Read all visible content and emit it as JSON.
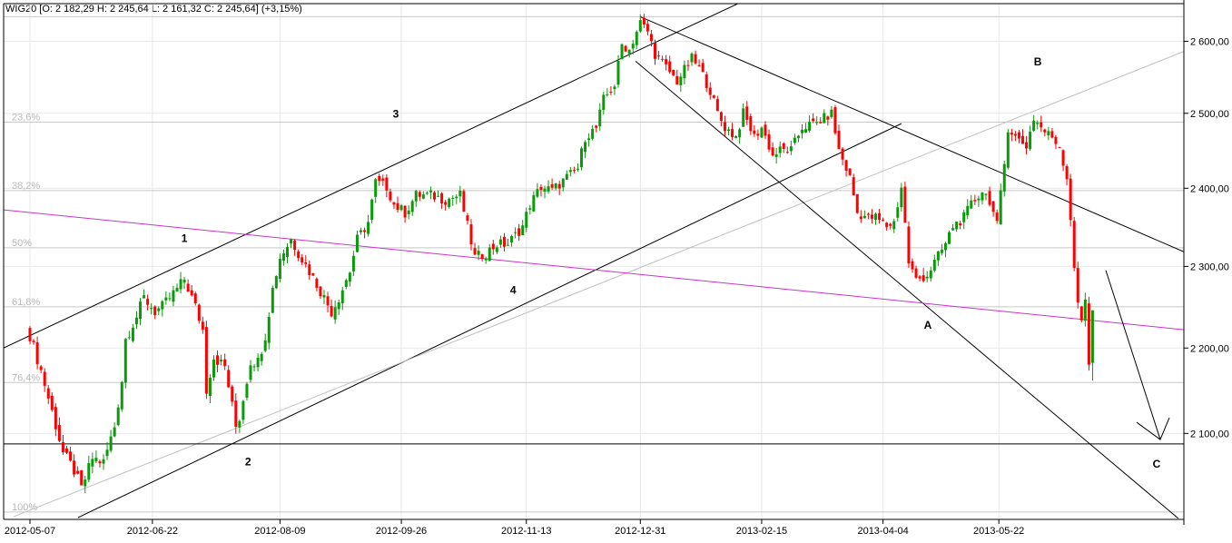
{
  "header": {
    "instrument": "WIG20",
    "ohlc_text": "WIG20 [O: 2 182,29  H: 2 245,64  L: 2 161,32  C: 2 245,64] (+3,15%)"
  },
  "chart_data": {
    "type": "candlestick",
    "title": "WIG20",
    "scale": "log",
    "ylim": [
      2000,
      2660
    ],
    "colors": {
      "up": "#0a9a0a",
      "down": "#ff0000",
      "grid": "#e8e8e8",
      "fib": "#c8c8c8",
      "magenta": "#cc33cc",
      "light_channel": "#c0c0c0"
    },
    "y_ticks": [
      {
        "value": 2600,
        "label": "2 600,00"
      },
      {
        "value": 2500,
        "label": "2 500,00"
      },
      {
        "value": 2400,
        "label": "2 400,00"
      },
      {
        "value": 2300,
        "label": "2 300,00"
      },
      {
        "value": 2200,
        "label": "2 200,00"
      },
      {
        "value": 2100,
        "label": "2 100,00"
      }
    ],
    "x_ticks": [
      {
        "index": 0,
        "label": "2012-05-07"
      },
      {
        "index": 33.3,
        "label": "2012-06-22"
      },
      {
        "index": 68,
        "label": "2012-08-09"
      },
      {
        "index": 101,
        "label": "2012-09-26"
      },
      {
        "index": 135,
        "label": "2012-11-13"
      },
      {
        "index": 166,
        "label": "2012-12-31"
      },
      {
        "index": 199,
        "label": "2013-02-15"
      },
      {
        "index": 232,
        "label": "2013-04-04"
      },
      {
        "index": 263.5,
        "label": "2013-05-22"
      }
    ],
    "fibonacci": {
      "high": 2635,
      "low": 2012,
      "levels": [
        {
          "ratio": 0.236,
          "label": "23,6%"
        },
        {
          "ratio": 0.382,
          "label": "38,2%"
        },
        {
          "ratio": 0.5,
          "label": "50%"
        },
        {
          "ratio": 0.618,
          "label": "61,8%"
        },
        {
          "ratio": 0.764,
          "label": "76,4%"
        },
        {
          "ratio": 1.0,
          "label": "100%"
        }
      ]
    },
    "close_path": [
      [
        0,
        2215
      ],
      [
        3,
        2173
      ],
      [
        5,
        2141
      ],
      [
        9,
        2078
      ],
      [
        12,
        2058
      ],
      [
        14,
        2037
      ],
      [
        17,
        2072
      ],
      [
        20,
        2067
      ],
      [
        23,
        2108
      ],
      [
        25,
        2162
      ],
      [
        26,
        2211
      ],
      [
        29,
        2238
      ],
      [
        31,
        2261
      ],
      [
        34,
        2244
      ],
      [
        36,
        2250
      ],
      [
        40,
        2272
      ],
      [
        42,
        2284
      ],
      [
        45,
        2250
      ],
      [
        47,
        2222
      ],
      [
        48,
        2151
      ],
      [
        50,
        2189
      ],
      [
        53,
        2178
      ],
      [
        56,
        2108
      ],
      [
        57,
        2118
      ],
      [
        60,
        2184
      ],
      [
        62,
        2184
      ],
      [
        64,
        2215
      ],
      [
        66,
        2272
      ],
      [
        68,
        2311
      ],
      [
        71,
        2334
      ],
      [
        73,
        2317
      ],
      [
        76,
        2294
      ],
      [
        80,
        2261
      ],
      [
        82,
        2244
      ],
      [
        84,
        2261
      ],
      [
        87,
        2294
      ],
      [
        89,
        2334
      ],
      [
        92,
        2356
      ],
      [
        94,
        2408
      ],
      [
        97,
        2402
      ],
      [
        99,
        2379
      ],
      [
        102,
        2368
      ],
      [
        105,
        2391
      ],
      [
        109,
        2391
      ],
      [
        113,
        2385
      ],
      [
        117,
        2391
      ],
      [
        119,
        2351
      ],
      [
        121,
        2311
      ],
      [
        124,
        2317
      ],
      [
        127,
        2328
      ],
      [
        130,
        2328
      ],
      [
        134,
        2351
      ],
      [
        136,
        2379
      ],
      [
        139,
        2402
      ],
      [
        142,
        2397
      ],
      [
        146,
        2414
      ],
      [
        149,
        2426
      ],
      [
        151,
        2468
      ],
      [
        154,
        2480
      ],
      [
        156,
        2519
      ],
      [
        159,
        2539
      ],
      [
        161,
        2595
      ],
      [
        163,
        2588
      ],
      [
        166,
        2627
      ],
      [
        168,
        2614
      ],
      [
        170,
        2582
      ],
      [
        172,
        2570
      ],
      [
        176,
        2544
      ],
      [
        180,
        2576
      ],
      [
        182,
        2563
      ],
      [
        185,
        2531
      ],
      [
        187,
        2500
      ],
      [
        189,
        2481
      ],
      [
        192,
        2468
      ],
      [
        194,
        2500
      ],
      [
        197,
        2468
      ],
      [
        199,
        2481
      ],
      [
        202,
        2443
      ],
      [
        204,
        2450
      ],
      [
        207,
        2450
      ],
      [
        210,
        2481
      ],
      [
        214,
        2487
      ],
      [
        218,
        2500
      ],
      [
        220,
        2450
      ],
      [
        223,
        2414
      ],
      [
        225,
        2368
      ],
      [
        228,
        2362
      ],
      [
        230,
        2362
      ],
      [
        233,
        2351
      ],
      [
        235,
        2356
      ],
      [
        237,
        2402
      ],
      [
        239,
        2305
      ],
      [
        241,
        2283
      ],
      [
        244,
        2289
      ],
      [
        246,
        2305
      ],
      [
        249,
        2328
      ],
      [
        251,
        2351
      ],
      [
        254,
        2362
      ],
      [
        256,
        2379
      ],
      [
        259,
        2397
      ],
      [
        261,
        2385
      ],
      [
        263,
        2351
      ],
      [
        265,
        2432
      ],
      [
        266,
        2481
      ],
      [
        268,
        2468
      ],
      [
        271,
        2456
      ],
      [
        273,
        2493
      ],
      [
        276,
        2475
      ],
      [
        278,
        2468
      ],
      [
        280,
        2456
      ],
      [
        282,
        2414
      ],
      [
        283,
        2362
      ],
      [
        284,
        2300
      ],
      [
        285,
        2250
      ],
      [
        286,
        2233
      ],
      [
        287,
        2261
      ],
      [
        288,
        2184
      ],
      [
        289,
        2245.64
      ]
    ],
    "last_candle": {
      "index": 289,
      "open": 2182.29,
      "high": 2245.64,
      "low": 2161.32,
      "close": 2245.64,
      "change_pct": 3.15
    },
    "trendlines": [
      {
        "name": "upper-channel-line",
        "from": [
          -7.2,
          2200
        ],
        "to": [
          193.8,
          2657
        ],
        "color": "#000000"
      },
      {
        "name": "lower-channel-line",
        "from": [
          13.1,
          2006
        ],
        "to": [
          237,
          2486
        ],
        "color": "#000000"
      },
      {
        "name": "light-channel-line",
        "from": [
          -4.4,
          2007
        ],
        "to": [
          314,
          2586
        ],
        "color": "#c0c0c0"
      },
      {
        "name": "upper-descending-line",
        "from": [
          166,
          2635
        ],
        "to": [
          314,
          2318
        ],
        "color": "#000000"
      },
      {
        "name": "lower-descending-line",
        "from": [
          164.7,
          2572
        ],
        "to": [
          312.3,
          2005
        ],
        "color": "#000000"
      },
      {
        "name": "magenta-trendline",
        "from": [
          -7.2,
          2372
        ],
        "to": [
          314,
          2222
        ],
        "color": "#cc33cc"
      },
      {
        "name": "horizontal-support-line",
        "from": [
          -7.2,
          2088
        ],
        "to": [
          314,
          2088
        ],
        "color": "#000000"
      }
    ],
    "arrow": {
      "from": [
        292.6,
        2295
      ],
      "to": [
        307.4,
        2093
      ]
    },
    "wave_labels": [
      {
        "text": "1",
        "index": 42,
        "price": 2331
      },
      {
        "text": "2",
        "index": 59.3,
        "price": 2064
      },
      {
        "text": "3",
        "index": 99.5,
        "price": 2494
      },
      {
        "text": "4",
        "index": 131.4,
        "price": 2266
      },
      {
        "text": "A",
        "index": 244.2,
        "price": 2223
      },
      {
        "text": "B",
        "index": 274.1,
        "price": 2566
      },
      {
        "text": "C",
        "index": 306.4,
        "price": 2061
      }
    ]
  }
}
